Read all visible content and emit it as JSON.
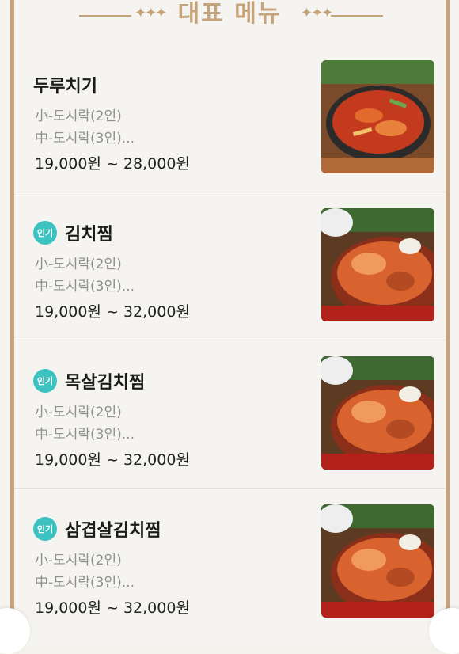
{
  "header": {
    "title": "대표 메뉴",
    "ornament": "✦✦✦"
  },
  "menu": {
    "items": [
      {
        "name": "두루치기",
        "popular": false,
        "badge": "",
        "line1": "小-도시락(2인)",
        "line2": "中-도시락(3인)...",
        "price": "19,000원 ~ 28,000원",
        "image_icon": "stir-fry-pan"
      },
      {
        "name": "김치찜",
        "popular": true,
        "badge": "인기",
        "line1": "小-도시락(2인)",
        "line2": "中-도시락(3인)...",
        "price": "19,000원 ~ 32,000원",
        "image_icon": "kimchi-stew"
      },
      {
        "name": "목살김치찜",
        "popular": true,
        "badge": "인기",
        "line1": "小-도시락(2인)",
        "line2": "中-도시락(3인)...",
        "price": "19,000원 ~ 32,000원",
        "image_icon": "kimchi-stew"
      },
      {
        "name": "삼겹살김치찜",
        "popular": true,
        "badge": "인기",
        "line1": "小-도시락(2인)",
        "line2": "中-도시락(3인)...",
        "price": "19,000원 ~ 32,000원",
        "image_icon": "kimchi-stew"
      }
    ]
  },
  "colors": {
    "accent_gold": "#c6a47b",
    "badge_teal": "#3cc2c0"
  }
}
